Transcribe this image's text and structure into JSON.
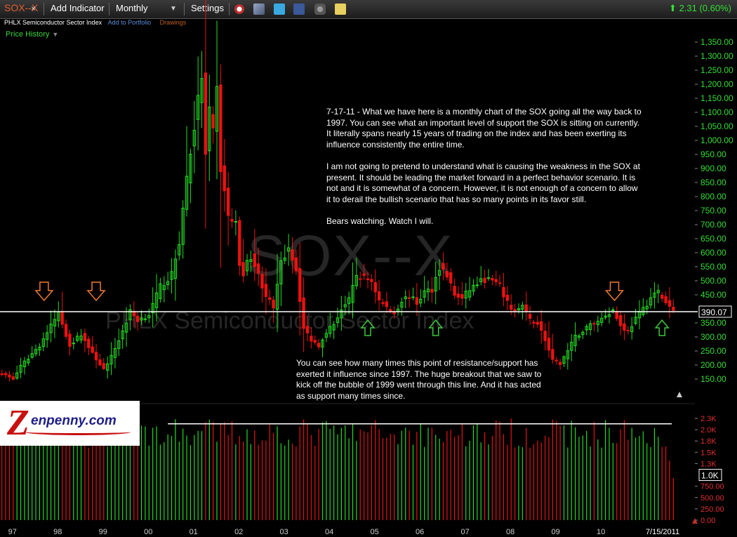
{
  "toolbar": {
    "symbol": "SOX--X",
    "symbol_close": "×",
    "add_indicator": "Add Indicator",
    "interval": "Monthly",
    "interval_caret": "▼",
    "settings": "Settings",
    "icons": [
      "alarm-clock-icon",
      "stacked-pages-icon",
      "twitter-icon",
      "facebook-icon",
      "camera-icon",
      "note-icon"
    ],
    "change": "2.31 (0.60%)",
    "change_arrow": "⬆"
  },
  "subbar": {
    "name": "PHLX Semiconductor Sector Index",
    "add_to_portfolio": "Add to Portfolio",
    "drawings": "Drawings"
  },
  "price_history": "Price History",
  "price_history_caret": "▼",
  "watermark": {
    "symbol": "SOX--X",
    "name": "PHLX Semiconductor Sector Index"
  },
  "note1": [
    "7-17-11 - What we have here is a monthly chart of the SOX going all the way back to 1997. You can see what an important level of support the SOX is sitting on currently. It literally spans nearly 15 years of trading on the index and has been exerting its influence consistently the entire time.",
    "I am not going to pretend to understand what is causing the weakness in the SOX at present. It should be leading the market forward in a perfect behavior scenario. It is not and it is somewhat of a concern. However, it is not enough of a concern to allow it to derail the bullish scenario that has so many points in its favor still.",
    "Bears watching. Watch I will."
  ],
  "note2": "You can see how many times this point of resistance/support has exerted it influence since 1997. The huge breakout that we saw to kick off the bubble of 1999 went through this line. And it has acted as support many times since.",
  "logo": {
    "letter": "Z",
    "text": "enpenny.com"
  },
  "colors": {
    "up": "#22dd22",
    "down": "#ee1111",
    "axis_text": "#33dd33",
    "axis_text_low": "#e03030",
    "support_line": "#ffffff",
    "arrow_down": "#f07a30",
    "arrow_up": "#3cc83c",
    "background": "#000000"
  },
  "chart_data": [
    {
      "type": "candlestick",
      "title": "SOX--X",
      "interval": "Monthly",
      "y_ticks": [
        150,
        200,
        250,
        300,
        350,
        400,
        450,
        500,
        550,
        600,
        650,
        700,
        750,
        800,
        850,
        900,
        950,
        1000,
        1050,
        1100,
        1150,
        1200,
        1250,
        1300,
        1350
      ],
      "y_tick_labels": [
        "150.00",
        "200.00",
        "250.00",
        "300.00",
        "350.00",
        "",
        "450.00",
        "500.00",
        "550.00",
        "600.00",
        "650.00",
        "700.00",
        "750.00",
        "800.00",
        "850.00",
        "900.00",
        "950.00",
        "1,000.00",
        "1,050.00",
        "1,100.00",
        "1,150.00",
        "1,200.00",
        "1,250.00",
        "1,300.00",
        "1,350.00"
      ],
      "ylim": [
        100,
        1400
      ],
      "last_price": 390.07,
      "last_price_label": "390.07",
      "support_level": 390,
      "x_labels": [
        {
          "year": 1997,
          "label": "97"
        },
        {
          "year": 1998,
          "label": "98"
        },
        {
          "year": 1999,
          "label": "99"
        },
        {
          "year": 2000,
          "label": "00"
        },
        {
          "year": 2001,
          "label": "01"
        },
        {
          "year": 2002,
          "label": "02"
        },
        {
          "year": 2003,
          "label": "03"
        },
        {
          "year": 2004,
          "label": "04"
        },
        {
          "year": 2005,
          "label": "05"
        },
        {
          "year": 2006,
          "label": "06"
        },
        {
          "year": 2007,
          "label": "07"
        },
        {
          "year": 2008,
          "label": "08"
        },
        {
          "year": 2009,
          "label": "09"
        },
        {
          "year": 2010,
          "label": "10"
        }
      ],
      "end_date_label": "7/15/2011",
      "start_date": "1996-12",
      "anchors": [
        [
          0,
          170
        ],
        [
          3,
          150
        ],
        [
          5,
          195
        ],
        [
          10,
          270
        ],
        [
          15,
          385
        ],
        [
          18,
          270
        ],
        [
          21,
          310
        ],
        [
          24,
          240
        ],
        [
          27,
          185
        ],
        [
          28,
          200
        ],
        [
          32,
          320
        ],
        [
          34,
          390
        ],
        [
          36,
          360
        ],
        [
          39,
          380
        ],
        [
          42,
          480
        ],
        [
          45,
          520
        ],
        [
          47,
          640
        ],
        [
          49,
          870
        ],
        [
          51,
          1050
        ],
        [
          53,
          1230
        ],
        [
          54,
          940
        ],
        [
          55,
          1100
        ],
        [
          56,
          1020
        ],
        [
          57,
          1180
        ],
        [
          58,
          900
        ],
        [
          60,
          730
        ],
        [
          62,
          700
        ],
        [
          63,
          560
        ],
        [
          64,
          530
        ],
        [
          66,
          590
        ],
        [
          68,
          520
        ],
        [
          70,
          450
        ],
        [
          72,
          400
        ],
        [
          74,
          560
        ],
        [
          76,
          625
        ],
        [
          78,
          540
        ],
        [
          80,
          330
        ],
        [
          82,
          290
        ],
        [
          84,
          270
        ],
        [
          86,
          320
        ],
        [
          88,
          345
        ],
        [
          90,
          400
        ],
        [
          92,
          430
        ],
        [
          94,
          520
        ],
        [
          96,
          510
        ],
        [
          98,
          500
        ],
        [
          100,
          430
        ],
        [
          102,
          405
        ],
        [
          104,
          385
        ],
        [
          106,
          430
        ],
        [
          108,
          445
        ],
        [
          110,
          420
        ],
        [
          112,
          460
        ],
        [
          114,
          470
        ],
        [
          116,
          550
        ],
        [
          118,
          520
        ],
        [
          120,
          450
        ],
        [
          122,
          435
        ],
        [
          124,
          470
        ],
        [
          126,
          490
        ],
        [
          128,
          505
        ],
        [
          130,
          500
        ],
        [
          132,
          480
        ],
        [
          134,
          420
        ],
        [
          136,
          390
        ],
        [
          138,
          410
        ],
        [
          140,
          360
        ],
        [
          142,
          350
        ],
        [
          144,
          290
        ],
        [
          146,
          215
        ],
        [
          148,
          205
        ],
        [
          150,
          250
        ],
        [
          152,
          300
        ],
        [
          154,
          320
        ],
        [
          156,
          345
        ],
        [
          158,
          355
        ],
        [
          160,
          380
        ],
        [
          162,
          395
        ],
        [
          164,
          340
        ],
        [
          166,
          320
        ],
        [
          168,
          365
        ],
        [
          170,
          400
        ],
        [
          172,
          440
        ],
        [
          174,
          460
        ],
        [
          176,
          420
        ],
        [
          178,
          390
        ]
      ],
      "volume_axis": {
        "ticks": [
          0,
          250,
          500,
          750,
          1000,
          1250,
          1500,
          1750,
          2000,
          2250
        ],
        "tick_labels": [
          "0.00",
          "250.00",
          "500.00",
          "750.00",
          "",
          "1.3K",
          "1.5K",
          "1.8K",
          "2.0K",
          "2.3K"
        ],
        "current_label": "1.0K",
        "ylim": [
          0,
          2350
        ],
        "moving_average": 2130
      },
      "annotations": {
        "resistance_arrows_down_years": [
          1997.85,
          1999.0,
          2010.45
        ],
        "support_arrows_up_years": [
          2005.0,
          2006.5,
          2011.5
        ]
      }
    }
  ]
}
